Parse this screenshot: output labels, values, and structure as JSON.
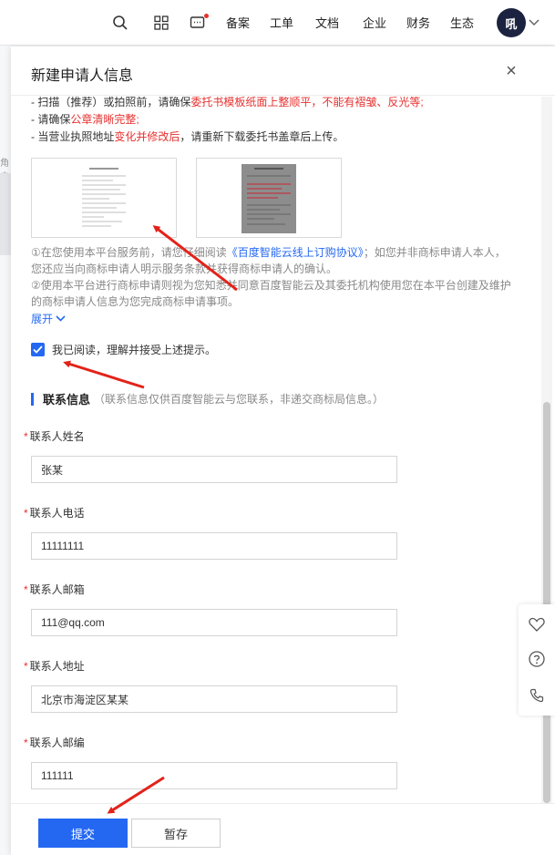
{
  "topbar": {
    "items": [
      "备案",
      "工单",
      "文档",
      "企业",
      "财务",
      "生态"
    ],
    "avatar_text": "吼",
    "icons": [
      "search-icon",
      "grid-icon",
      "message-icon",
      "chevron-down-icon"
    ]
  },
  "background": {
    "partial_text": "角户"
  },
  "dialog": {
    "title": "新建申请人信息",
    "close_label": "×",
    "notices": {
      "line1_prefix": "- 扫描（推荐）或拍照前，请确保",
      "line1_red": "委托书模板纸面上整顺平，不能有褶皱、反光等;",
      "line2_prefix": "- 请确保",
      "line2_red": "公章清晰完整;",
      "line3_prefix": "- 当营业执照地址",
      "line3_red": "变化并修改后",
      "line3_suffix": "，请重新下载委托书盖章后上传。"
    },
    "terms": {
      "p1_a": "①在您使用本平台服务前，请您仔细阅读",
      "p1_link": "《百度智能云线上订购协议》",
      "p1_b": "；如您并非商标申请人本人，",
      "p1_c": "您还应当向商标申请人明示服务条款并获得商标申请人的确认。",
      "p2_a": "②使用本平台进行商标申请则视为您知悉并同意百度智能云及其委托机构使用您在本平台创建及维护",
      "p2_b": "的商标申请人信息为您完成商标申请事项。",
      "expand_label": "展开"
    },
    "agree_label": "我已阅读，理解并接受上述提示。",
    "agree_checked": true,
    "section": {
      "title": "联系信息",
      "subtitle": "（联系信息仅供百度智能云与您联系，非递交商标局信息。）"
    },
    "fields": [
      {
        "label": "联系人姓名",
        "value": "张某"
      },
      {
        "label": "联系人电话",
        "value": "11111111"
      },
      {
        "label": "联系人邮箱",
        "value": "111@qq.com"
      },
      {
        "label": "联系人地址",
        "value": "北京市海淀区某某"
      },
      {
        "label": "联系人邮编",
        "value": "111111"
      }
    ],
    "required_mark": "*",
    "submit_label": "提交",
    "draft_label": "暂存"
  },
  "colors": {
    "primary": "#2468f2",
    "danger": "#e6312f",
    "annotation": "#e2231a"
  },
  "side_toolbar": {
    "icons": [
      "heart-icon",
      "help-icon",
      "phone-icon"
    ]
  }
}
